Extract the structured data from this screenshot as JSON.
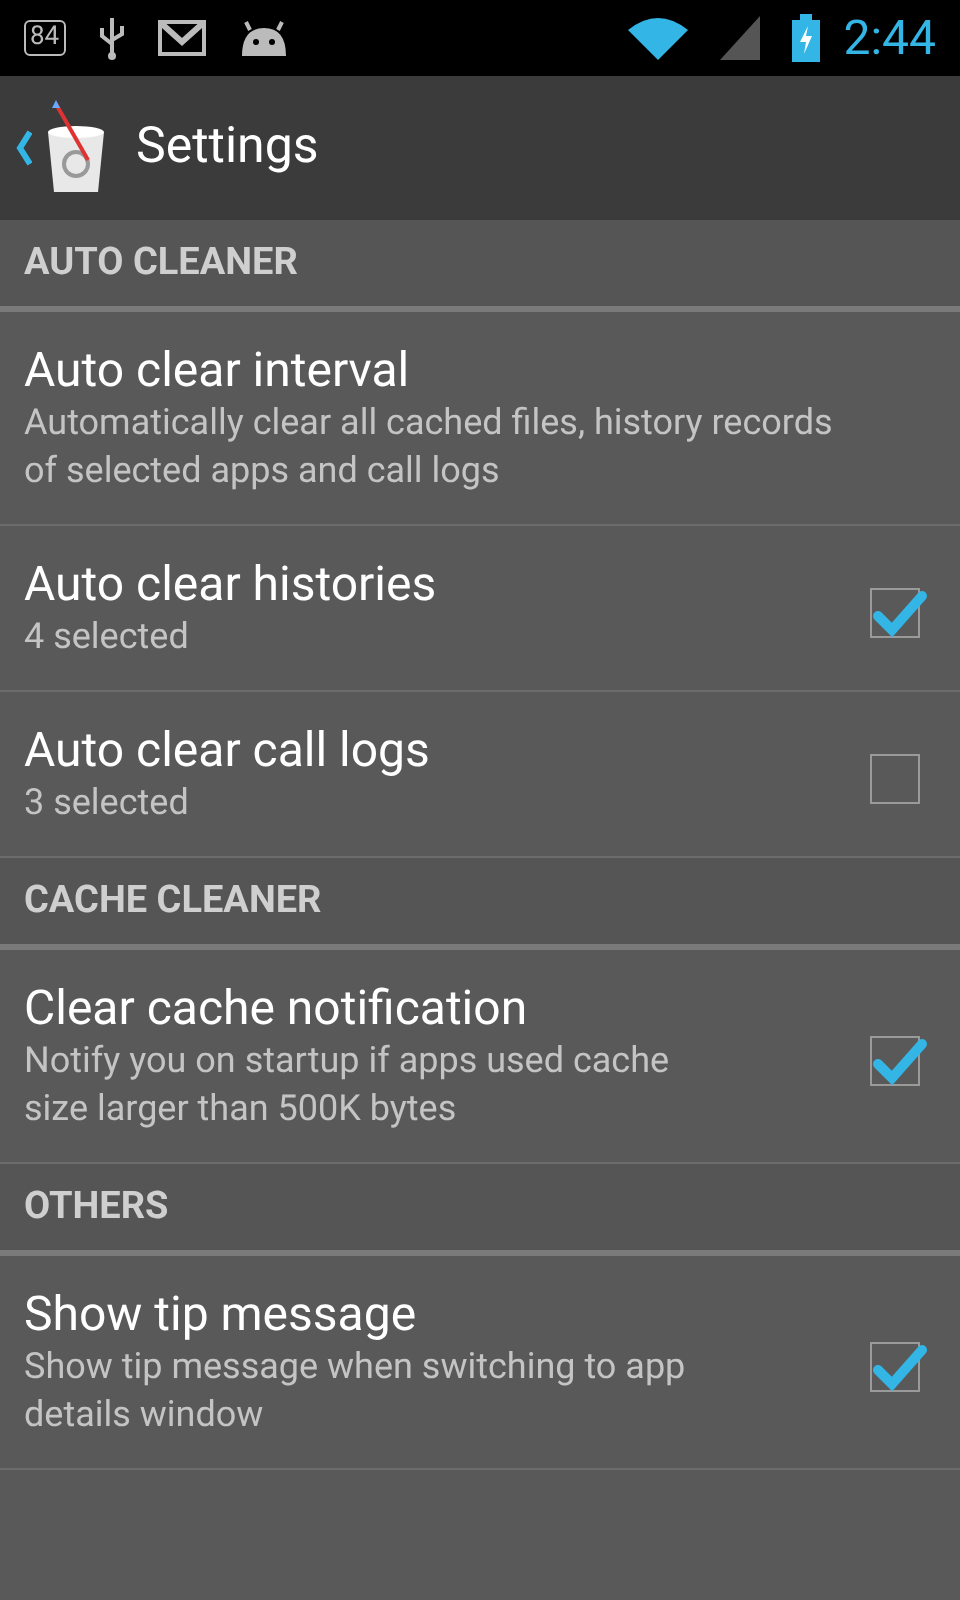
{
  "status_bar": {
    "notification_count": "84",
    "time": "2:44"
  },
  "app_bar": {
    "title": "Settings"
  },
  "sections": [
    {
      "header": "AUTO CLEANER",
      "items": [
        {
          "kind": "plain",
          "title": "Auto clear interval",
          "summary": "Automatically clear all cached files, history records of selected apps and call logs"
        },
        {
          "kind": "checkbox",
          "title": "Auto clear histories",
          "summary": "4 selected",
          "checked": true
        },
        {
          "kind": "checkbox",
          "title": "Auto clear call logs",
          "summary": "3 selected",
          "checked": false
        }
      ]
    },
    {
      "header": "CACHE CLEANER",
      "items": [
        {
          "kind": "checkbox",
          "title": "Clear cache notification",
          "summary": "Notify you on startup if apps used cache size larger than 500K bytes",
          "checked": true
        }
      ]
    },
    {
      "header": "OTHERS",
      "items": [
        {
          "kind": "checkbox",
          "title": "Show tip message",
          "summary": "Show tip message when switching to app details window",
          "checked": true
        }
      ]
    }
  ]
}
